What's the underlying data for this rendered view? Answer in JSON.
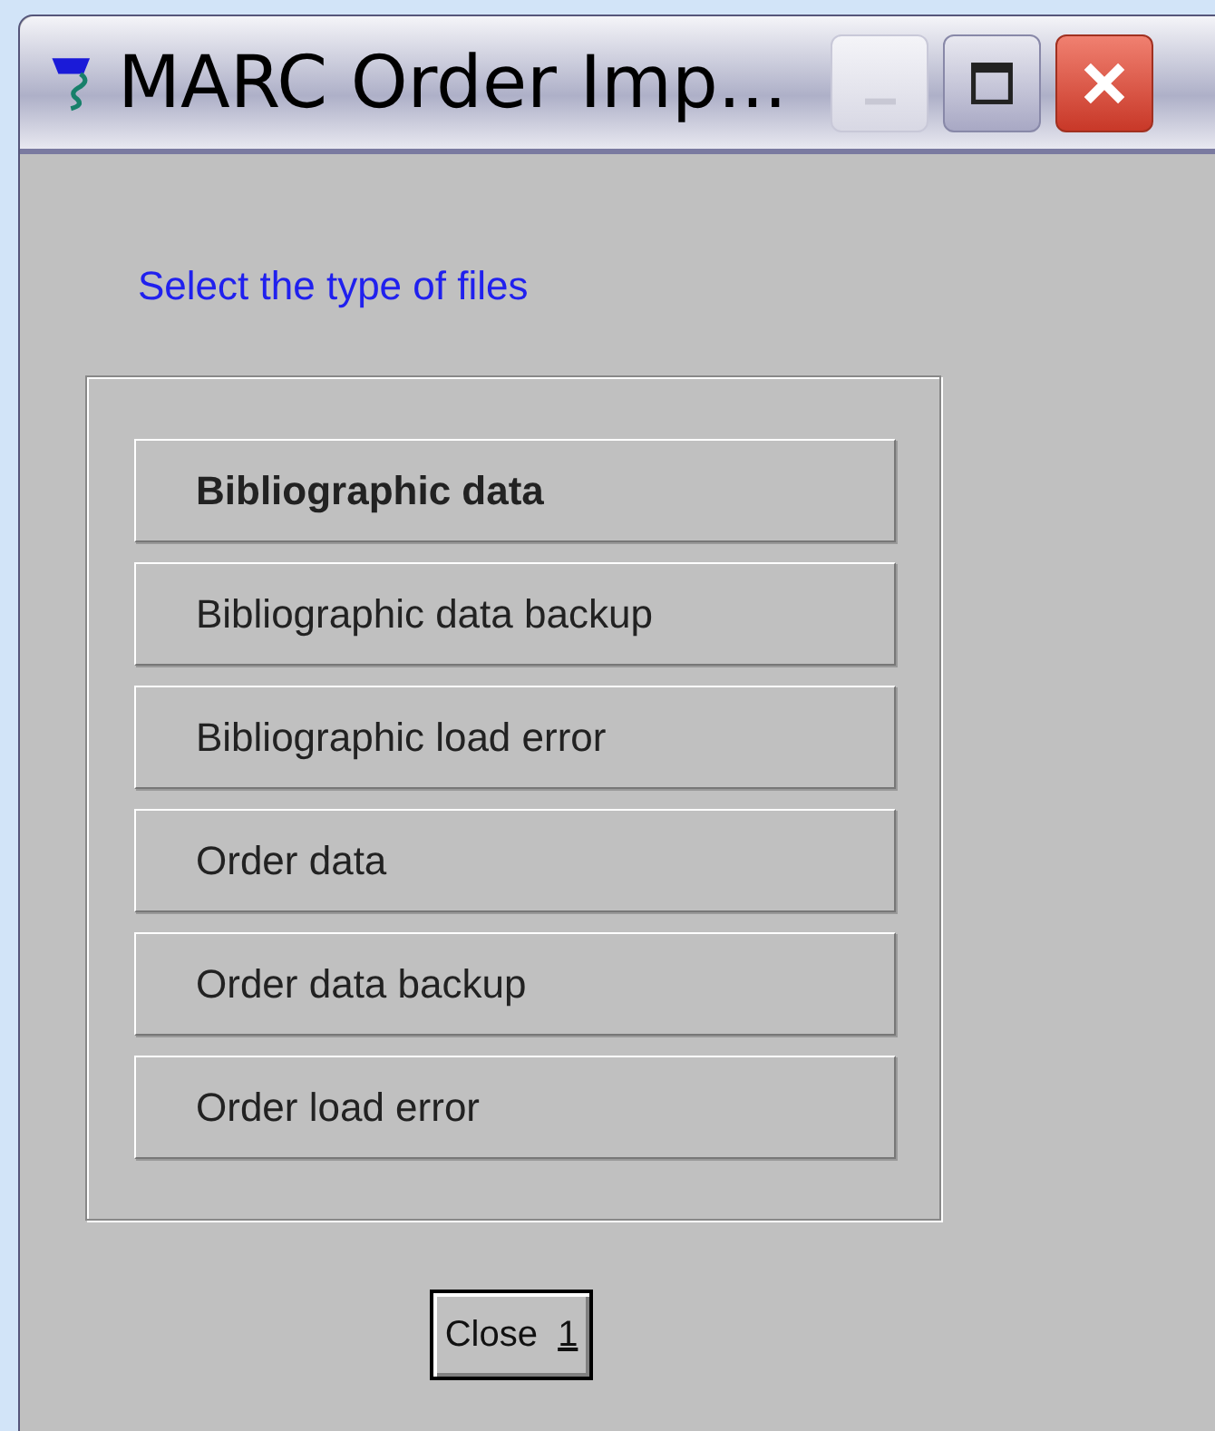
{
  "window": {
    "title": "MARC Order Imp..."
  },
  "prompt": "Select the type of files",
  "file_types": [
    {
      "label": "Bibliographic data",
      "selected": true
    },
    {
      "label": "Bibliographic data backup",
      "selected": false
    },
    {
      "label": "Bibliographic load error",
      "selected": false
    },
    {
      "label": "Order data",
      "selected": false
    },
    {
      "label": "Order data backup",
      "selected": false
    },
    {
      "label": "Order load error",
      "selected": false
    }
  ],
  "close_button": {
    "label": "Close",
    "shortcut": "1"
  }
}
